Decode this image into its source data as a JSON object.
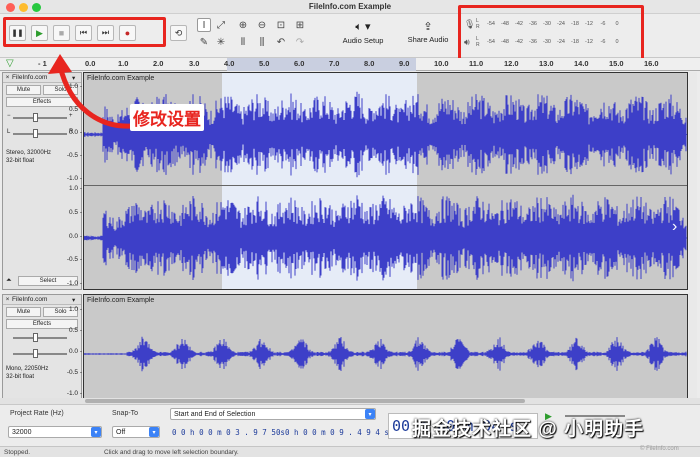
{
  "window": {
    "title": "FileInfo.com Example"
  },
  "toolbar": {
    "transport": [
      {
        "name": "pause",
        "glyph": "❚❚"
      },
      {
        "name": "play",
        "glyph": "▶"
      },
      {
        "name": "stop",
        "glyph": "■"
      },
      {
        "name": "skip-start",
        "glyph": "⏮"
      },
      {
        "name": "skip-end",
        "glyph": "⏭"
      },
      {
        "name": "record",
        "glyph": "●"
      }
    ],
    "audio_setup_label": "Audio Setup",
    "share_audio_label": "Share Audio",
    "meter_ticks": [
      "-54",
      "-48",
      "-42",
      "-36",
      "-30",
      "-24",
      "-18",
      "-12",
      "-6",
      "0"
    ],
    "meter_channels": [
      "L",
      "R"
    ]
  },
  "ruler": {
    "ticks": [
      "- 1",
      "0.0",
      "1.0",
      "2.0",
      "3.0",
      "4.0",
      "5.0",
      "6.0",
      "7.0",
      "8.0",
      "9.0",
      "10.0",
      "11.0",
      "12.0",
      "13.0",
      "14.0",
      "15.0",
      "16.0"
    ]
  },
  "tracks": [
    {
      "name": "FileInfo.com",
      "clip_name": "FileInfo.com Example",
      "mute_label": "Mute",
      "solo_label": "Solo",
      "effects_label": "Effects",
      "info_line1": "Stereo, 32000Hz",
      "info_line2": "32-bit float",
      "select_label": "Select",
      "y_ticks": [
        "1.0",
        "0.5",
        "0.0",
        "-0.5",
        "-1.0"
      ]
    },
    {
      "name": "FileInfo.com",
      "clip_name": "FileInfo.com Example",
      "mute_label": "Mute",
      "solo_label": "Solo",
      "effects_label": "Effects",
      "info_line1": "Mono, 22050Hz",
      "info_line2": "32-bit float",
      "select_label": "Select",
      "y_ticks": [
        "1.0",
        "0.5",
        "0.0",
        "-0.5",
        "-1.0"
      ]
    }
  ],
  "bottom": {
    "project_rate_label": "Project Rate (Hz)",
    "project_rate_value": "32000",
    "snap_to_label": "Snap-To",
    "snap_to_value": "Off",
    "selection_mode": "Start and End of Selection",
    "sel_start": "0 0 h 0 0 m 0 3 . 9 7 5 s",
    "sel_end": "0 0 h 0 0 m 0 9 . 4 9 4 s",
    "big_time": "00 h 00 m 04 s"
  },
  "status": {
    "state": "Stopped.",
    "hint": "Click and drag to move left selection boundary."
  },
  "annotation": {
    "label": "修改设置"
  },
  "watermark": {
    "text": "掘金技术社区 @ 小明助手",
    "sub": "© FileInfo.com"
  },
  "colors": {
    "waveform": "#3d3fc8",
    "selection": "#e6ecf7",
    "highlight": "#e8251f"
  }
}
